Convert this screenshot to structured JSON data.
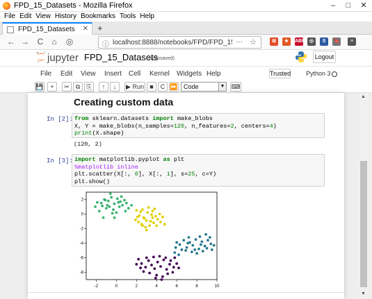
{
  "window": {
    "title": "FPD_15_Datasets - Mozilla Firefox",
    "minimize": "–",
    "maximize": "□",
    "close": "✕"
  },
  "menubar": [
    "File",
    "Edit",
    "View",
    "History",
    "Bookmarks",
    "Tools",
    "Help"
  ],
  "tab": {
    "label": "FPD_15_Datasets",
    "close": "✕",
    "new": "+"
  },
  "nav": {
    "back": "←",
    "forward": "→",
    "reload": "C",
    "home": "⌂",
    "rss": "◎",
    "url": "localhost:8888/notebooks/FPD/FPD_15",
    "page_menu": "···",
    "star": "☆"
  },
  "extensions": [
    {
      "label": "⊞",
      "color": "#e34c26"
    },
    {
      "label": "★",
      "color": "#e25822"
    },
    {
      "label": "ABP",
      "color": "#c70d2c"
    },
    {
      "label": "◎",
      "color": "#555555"
    },
    {
      "label": "S",
      "color": "#2c5aa0"
    },
    {
      "label": "🔖",
      "color": "#777777"
    },
    {
      "label": "≡",
      "color": "#555555"
    }
  ],
  "jupyter": {
    "brand": "jupyter",
    "notebook_name": "FPD_15_Datasets",
    "autosave": "(autosaved)",
    "logout": "Logout"
  },
  "jmenu": [
    "File",
    "Edit",
    "View",
    "Insert",
    "Cell",
    "Kernel",
    "Widgets",
    "Help"
  ],
  "trusted": "Trusted",
  "kernel": "Python 3",
  "toolbar": {
    "save": "💾",
    "add": "+",
    "cut": "✂",
    "copy": "⧉",
    "paste": "⎘",
    "up": "↑",
    "down": "↓",
    "run": "▶ Run",
    "stop": "■",
    "restart": "C",
    "restart_run": "⏩",
    "cell_type": "Code",
    "palette": "⌨"
  },
  "heading": "Creating custom data",
  "cell2": {
    "prompt": "In [2]:",
    "line1_kw": "from",
    "line1_mid": " sklearn.datasets ",
    "line1_kw2": "import",
    "line1_end": " make_blobs",
    "line2": "X, Y = make_blobs(n_samples=",
    "line2_n1": "120",
    "line2_b": ", n_features=",
    "line2_n2": "2",
    "line2_c": ", centers=",
    "line2_n3": "4",
    "line2_d": ")",
    "line3_fn": "print",
    "line3_rest": "(X.shape)",
    "output": "(120, 2)"
  },
  "cell3": {
    "prompt": "In [3]:",
    "l1_kw": "import",
    "l1_mid": " matplotlib.pyplot ",
    "l1_kw2": "as",
    "l1_end": " plt",
    "l2": "%matplotlib inline",
    "l3_a": "plt.scatter(X[:, ",
    "l3_n1": "0",
    "l3_b": "], X[:, ",
    "l3_n2": "1",
    "l3_c": "], s=",
    "l3_n3": "25",
    "l3_d": ", c=Y)",
    "l4": "plt.show()"
  },
  "chart_data": {
    "type": "scatter",
    "xlim": [
      -3,
      10
    ],
    "ylim": [
      -9,
      3
    ],
    "xticks": [
      -2,
      0,
      2,
      4,
      6,
      8,
      10
    ],
    "yticks": [
      2,
      0,
      -2,
      -4,
      -6,
      -8
    ],
    "series": [
      {
        "color": "#3cb371",
        "points": [
          [
            -2.1,
            1.0
          ],
          [
            -1.5,
            1.5
          ],
          [
            -1.2,
            2.0
          ],
          [
            -0.8,
            1.8
          ],
          [
            -0.5,
            2.3
          ],
          [
            -0.2,
            1.4
          ],
          [
            0.1,
            2.1
          ],
          [
            0.4,
            1.7
          ],
          [
            -1.0,
            0.8
          ],
          [
            -0.3,
            0.6
          ],
          [
            0.6,
            1.2
          ],
          [
            -1.7,
            0.4
          ],
          [
            0.0,
            0.2
          ],
          [
            -0.9,
            1.2
          ],
          [
            0.8,
            1.9
          ],
          [
            -0.6,
            2.8
          ],
          [
            1.0,
            1.5
          ],
          [
            -1.3,
            -0.5
          ],
          [
            -0.2,
            -0.5
          ],
          [
            0.3,
            1.0
          ],
          [
            -1.9,
            1.6
          ],
          [
            0.5,
            2.4
          ],
          [
            -0.4,
            0.1
          ],
          [
            1.2,
            0.8
          ],
          [
            -1.1,
            1.9
          ],
          [
            0.2,
            1.6
          ],
          [
            -0.7,
            1.0
          ],
          [
            1.5,
            1.2
          ],
          [
            -1.4,
            1.1
          ],
          [
            0.9,
            0.4
          ]
        ]
      },
      {
        "color": "#e0d000",
        "points": [
          [
            2.0,
            0.5
          ],
          [
            2.3,
            -0.2
          ],
          [
            2.6,
            0.6
          ],
          [
            2.8,
            -0.6
          ],
          [
            3.1,
            0.2
          ],
          [
            3.4,
            -1.0
          ],
          [
            3.6,
            0.4
          ],
          [
            3.9,
            -0.3
          ],
          [
            2.2,
            -1.1
          ],
          [
            2.5,
            -1.4
          ],
          [
            3.0,
            -0.9
          ],
          [
            3.3,
            -1.6
          ],
          [
            3.7,
            -1.2
          ],
          [
            4.1,
            -0.7
          ],
          [
            4.4,
            -1.1
          ],
          [
            2.1,
            -0.4
          ],
          [
            3.5,
            -0.1
          ],
          [
            2.9,
            -1.8
          ],
          [
            4.6,
            -0.4
          ],
          [
            1.9,
            -0.8
          ],
          [
            3.2,
            0.9
          ],
          [
            2.7,
            -0.5
          ],
          [
            4.0,
            -1.6
          ],
          [
            3.8,
            0.7
          ],
          [
            2.4,
            0.3
          ],
          [
            4.3,
            0.0
          ],
          [
            3.0,
            -2.2
          ],
          [
            2.6,
            -1.6
          ],
          [
            4.8,
            -1.4
          ],
          [
            3.6,
            -0.5
          ]
        ]
      },
      {
        "color": "#2a788e",
        "points": [
          [
            6.3,
            -4.2
          ],
          [
            6.7,
            -3.6
          ],
          [
            7.0,
            -4.6
          ],
          [
            7.3,
            -3.9
          ],
          [
            7.6,
            -4.3
          ],
          [
            7.9,
            -3.5
          ],
          [
            8.2,
            -4.8
          ],
          [
            8.5,
            -3.8
          ],
          [
            8.8,
            -4.4
          ],
          [
            9.1,
            -3.6
          ],
          [
            9.4,
            -4.1
          ],
          [
            6.0,
            -3.9
          ],
          [
            6.9,
            -5.0
          ],
          [
            7.5,
            -5.2
          ],
          [
            8.0,
            -5.4
          ],
          [
            8.6,
            -5.1
          ],
          [
            9.0,
            -4.7
          ],
          [
            9.5,
            -4.9
          ],
          [
            6.5,
            -4.9
          ],
          [
            7.2,
            -3.2
          ],
          [
            8.3,
            -3.1
          ],
          [
            8.9,
            -2.8
          ],
          [
            9.3,
            -3.2
          ],
          [
            5.8,
            -5.3
          ],
          [
            6.2,
            -5.6
          ],
          [
            7.8,
            -4.9
          ],
          [
            8.4,
            -4.2
          ],
          [
            9.7,
            -4.3
          ],
          [
            5.9,
            -4.6
          ],
          [
            7.1,
            -4.0
          ]
        ]
      },
      {
        "color": "#440154",
        "points": [
          [
            2.2,
            -6.2
          ],
          [
            2.5,
            -6.8
          ],
          [
            2.9,
            -7.3
          ],
          [
            3.2,
            -6.4
          ],
          [
            3.5,
            -7.0
          ],
          [
            3.8,
            -7.5
          ],
          [
            4.1,
            -6.6
          ],
          [
            4.4,
            -7.2
          ],
          [
            4.7,
            -6.3
          ],
          [
            5.0,
            -7.6
          ],
          [
            5.3,
            -6.9
          ],
          [
            5.6,
            -8.0
          ],
          [
            2.7,
            -7.9
          ],
          [
            3.3,
            -8.1
          ],
          [
            4.0,
            -8.4
          ],
          [
            4.6,
            -8.6
          ],
          [
            5.1,
            -8.2
          ],
          [
            5.7,
            -7.3
          ],
          [
            2.4,
            -7.4
          ],
          [
            3.0,
            -6.0
          ],
          [
            3.7,
            -5.9
          ],
          [
            4.3,
            -5.8
          ],
          [
            4.9,
            -6.0
          ],
          [
            5.4,
            -6.4
          ],
          [
            6.0,
            -6.8
          ],
          [
            6.2,
            -7.4
          ],
          [
            3.9,
            -8.8
          ],
          [
            4.5,
            -9.0
          ],
          [
            2.0,
            -6.9
          ],
          [
            5.8,
            -6.0
          ]
        ]
      }
    ]
  }
}
